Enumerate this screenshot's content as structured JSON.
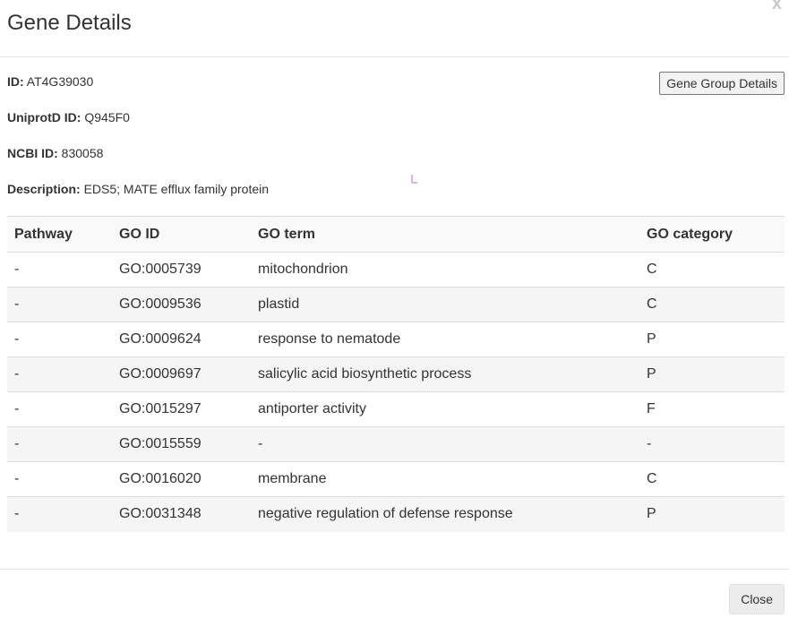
{
  "modal": {
    "title": "Gene Details",
    "close_x": "x",
    "group_button": "Gene Group Details",
    "close_button": "Close"
  },
  "gene": {
    "id_label": "ID:",
    "id_value": "AT4G39030",
    "uniprot_label": "UniprotD ID:",
    "uniprot_value": "Q945F0",
    "ncbi_label": "NCBI ID:",
    "ncbi_value": "830058",
    "description_label": "Description:",
    "description_value": "EDS5; MATE efflux family protein"
  },
  "table": {
    "headers": [
      "Pathway",
      "GO ID",
      "GO term",
      "GO category"
    ],
    "rows": [
      [
        "-",
        "GO:0005739",
        "mitochondrion",
        "C"
      ],
      [
        "-",
        "GO:0009536",
        "plastid",
        "C"
      ],
      [
        "-",
        "GO:0009624",
        "response to nematode",
        "P"
      ],
      [
        "-",
        "GO:0009697",
        "salicylic acid biosynthetic process",
        "P"
      ],
      [
        "-",
        "GO:0015297",
        "antiporter activity",
        "F"
      ],
      [
        "-",
        "GO:0015559",
        "-",
        "-"
      ],
      [
        "-",
        "GO:0016020",
        "membrane",
        "C"
      ],
      [
        "-",
        "GO:0031348",
        "negative regulation of defense response",
        "P"
      ]
    ]
  }
}
